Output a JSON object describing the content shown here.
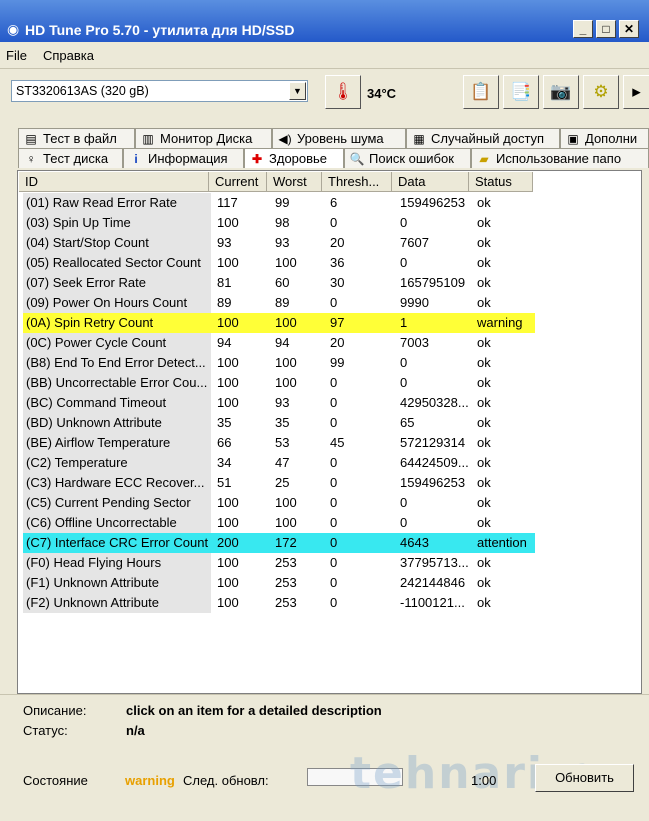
{
  "window": {
    "title": "HD Tune Pro 5.70 - утилита для HD/SSD",
    "minimize": "_",
    "maximize": "□",
    "close": "✕"
  },
  "menu": {
    "file": "File",
    "help": "Справка"
  },
  "toolbar": {
    "drive": "ST3320613AS (320 gB)",
    "temperature": "34°C"
  },
  "tabs_top": [
    {
      "label": "Тест в файл",
      "icon": "file-icon"
    },
    {
      "label": "Монитор Диска",
      "icon": "chart-icon"
    },
    {
      "label": "Уровень шума",
      "icon": "speaker-icon"
    },
    {
      "label": "Случайный доступ",
      "icon": "random-icon"
    },
    {
      "label": "Дополни",
      "icon": "extra-icon"
    }
  ],
  "tabs_bottom": [
    {
      "label": "Тест диска",
      "icon": "benchmark-icon"
    },
    {
      "label": "Информация",
      "icon": "info-icon"
    },
    {
      "label": "Здоровье",
      "icon": "health-cross-icon"
    },
    {
      "label": "Поиск ошибок",
      "icon": "search-icon"
    },
    {
      "label": "Использование папо",
      "icon": "folder-icon"
    }
  ],
  "table": {
    "headers": [
      "ID",
      "Current",
      "Worst",
      "Thresh...",
      "Data",
      "Status"
    ],
    "rows": [
      {
        "id": "(01) Raw Read Error Rate",
        "current": "117",
        "worst": "99",
        "thresh": "6",
        "data": "159496253",
        "status": "ok"
      },
      {
        "id": "(03) Spin Up Time",
        "current": "100",
        "worst": "98",
        "thresh": "0",
        "data": "0",
        "status": "ok"
      },
      {
        "id": "(04) Start/Stop Count",
        "current": "93",
        "worst": "93",
        "thresh": "20",
        "data": "7607",
        "status": "ok"
      },
      {
        "id": "(05) Reallocated Sector Count",
        "current": "100",
        "worst": "100",
        "thresh": "36",
        "data": "0",
        "status": "ok"
      },
      {
        "id": "(07) Seek Error Rate",
        "current": "81",
        "worst": "60",
        "thresh": "30",
        "data": "165795109",
        "status": "ok"
      },
      {
        "id": "(09) Power On Hours Count",
        "current": "89",
        "worst": "89",
        "thresh": "0",
        "data": "9990",
        "status": "ok"
      },
      {
        "id": "(0A) Spin Retry Count",
        "current": "100",
        "worst": "100",
        "thresh": "97",
        "data": "1",
        "status": "warning"
      },
      {
        "id": "(0C) Power Cycle Count",
        "current": "94",
        "worst": "94",
        "thresh": "20",
        "data": "7003",
        "status": "ok"
      },
      {
        "id": "(B8) End To End Error Detect...",
        "current": "100",
        "worst": "100",
        "thresh": "99",
        "data": "0",
        "status": "ok"
      },
      {
        "id": "(BB) Uncorrectable Error Cou...",
        "current": "100",
        "worst": "100",
        "thresh": "0",
        "data": "0",
        "status": "ok"
      },
      {
        "id": "(BC) Command Timeout",
        "current": "100",
        "worst": "93",
        "thresh": "0",
        "data": "42950328...",
        "status": "ok"
      },
      {
        "id": "(BD) Unknown Attribute",
        "current": "35",
        "worst": "35",
        "thresh": "0",
        "data": "65",
        "status": "ok"
      },
      {
        "id": "(BE) Airflow Temperature",
        "current": "66",
        "worst": "53",
        "thresh": "45",
        "data": "572129314",
        "status": "ok"
      },
      {
        "id": "(C2) Temperature",
        "current": "34",
        "worst": "47",
        "thresh": "0",
        "data": "64424509...",
        "status": "ok"
      },
      {
        "id": "(C3) Hardware ECC Recover...",
        "current": "51",
        "worst": "25",
        "thresh": "0",
        "data": "159496253",
        "status": "ok"
      },
      {
        "id": "(C5) Current Pending Sector",
        "current": "100",
        "worst": "100",
        "thresh": "0",
        "data": "0",
        "status": "ok"
      },
      {
        "id": "(C6) Offline Uncorrectable",
        "current": "100",
        "worst": "100",
        "thresh": "0",
        "data": "0",
        "status": "ok"
      },
      {
        "id": "(C7) Interface CRC Error Count",
        "current": "200",
        "worst": "172",
        "thresh": "0",
        "data": "4643",
        "status": "attention"
      },
      {
        "id": "(F0) Head Flying Hours",
        "current": "100",
        "worst": "253",
        "thresh": "0",
        "data": "37795713...",
        "status": "ok"
      },
      {
        "id": "(F1) Unknown Attribute",
        "current": "100",
        "worst": "253",
        "thresh": "0",
        "data": "242144846",
        "status": "ok"
      },
      {
        "id": "(F2) Unknown Attribute",
        "current": "100",
        "worst": "253",
        "thresh": "0",
        "data": "-1100121...",
        "status": "ok"
      }
    ]
  },
  "info": {
    "description_label": "Описание:",
    "description_value": "click on an item for a detailed description",
    "status_label": "Статус:",
    "status_value": "n/a"
  },
  "footer": {
    "state_label": "Состояние",
    "state_value": "warning",
    "next_update_label": "След. обновл:",
    "timer": "1:00",
    "refresh_button": "Обновить"
  },
  "watermark": "tehnari.ru",
  "colors": {
    "warning_row": "#ffff37",
    "attention_row": "#38e8f0",
    "state_warning": "#e8a000"
  }
}
